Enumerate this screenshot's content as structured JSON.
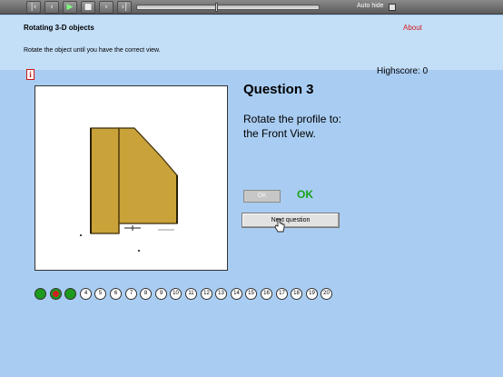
{
  "toolbar": {
    "buttons": [
      {
        "icon": "skip-start-icon",
        "glyph": "|‹"
      },
      {
        "icon": "step-back-icon",
        "glyph": "‹"
      },
      {
        "icon": "play-icon",
        "glyph": "▶"
      },
      {
        "icon": "stop-icon",
        "glyph": "■"
      },
      {
        "icon": "step-forward-icon",
        "glyph": "›"
      },
      {
        "icon": "skip-end-icon",
        "glyph": "›|"
      }
    ],
    "seek_position": 0.43,
    "autohide_label": "Auto hide",
    "autohide_checked": false
  },
  "header": {
    "title": "Rotating 3-D objects",
    "about_label": "About",
    "instruction": "Rotate the object until you have the correct view."
  },
  "info_icon_glyph": "i",
  "highscore_text": "Highscore: 0",
  "question": {
    "title": "Question 3",
    "prompt_line1": "Rotate the profile to:",
    "prompt_line2": "the Front View."
  },
  "ok_button_label": "OK",
  "feedback_text": "OK",
  "next_button_label": "Next question",
  "progress": {
    "items": [
      {
        "label": "",
        "status": "correct"
      },
      {
        "label": "",
        "status": "wrong"
      },
      {
        "label": "",
        "status": "correct"
      },
      {
        "label": "4",
        "status": "pending"
      },
      {
        "label": "5",
        "status": "pending"
      },
      {
        "label": "6",
        "status": "pending"
      },
      {
        "label": "7",
        "status": "pending"
      },
      {
        "label": "8",
        "status": "pending"
      },
      {
        "label": "9",
        "status": "pending"
      },
      {
        "label": "10",
        "status": "pending"
      },
      {
        "label": "11",
        "status": "pending"
      },
      {
        "label": "12",
        "status": "pending"
      },
      {
        "label": "13",
        "status": "pending"
      },
      {
        "label": "14",
        "status": "pending"
      },
      {
        "label": "15",
        "status": "pending"
      },
      {
        "label": "16",
        "status": "pending"
      },
      {
        "label": "17",
        "status": "pending"
      },
      {
        "label": "18",
        "status": "pending"
      },
      {
        "label": "19",
        "status": "pending"
      },
      {
        "label": "20",
        "status": "pending"
      }
    ]
  },
  "colors": {
    "background": "#a9cdf2",
    "header_band": "#c3def7",
    "about_link": "#d21e1e",
    "feedback_ok": "#1aa31a",
    "object_fill": "#c9a23a",
    "correct": "#1e9a1e",
    "wrong": "#d02020"
  }
}
